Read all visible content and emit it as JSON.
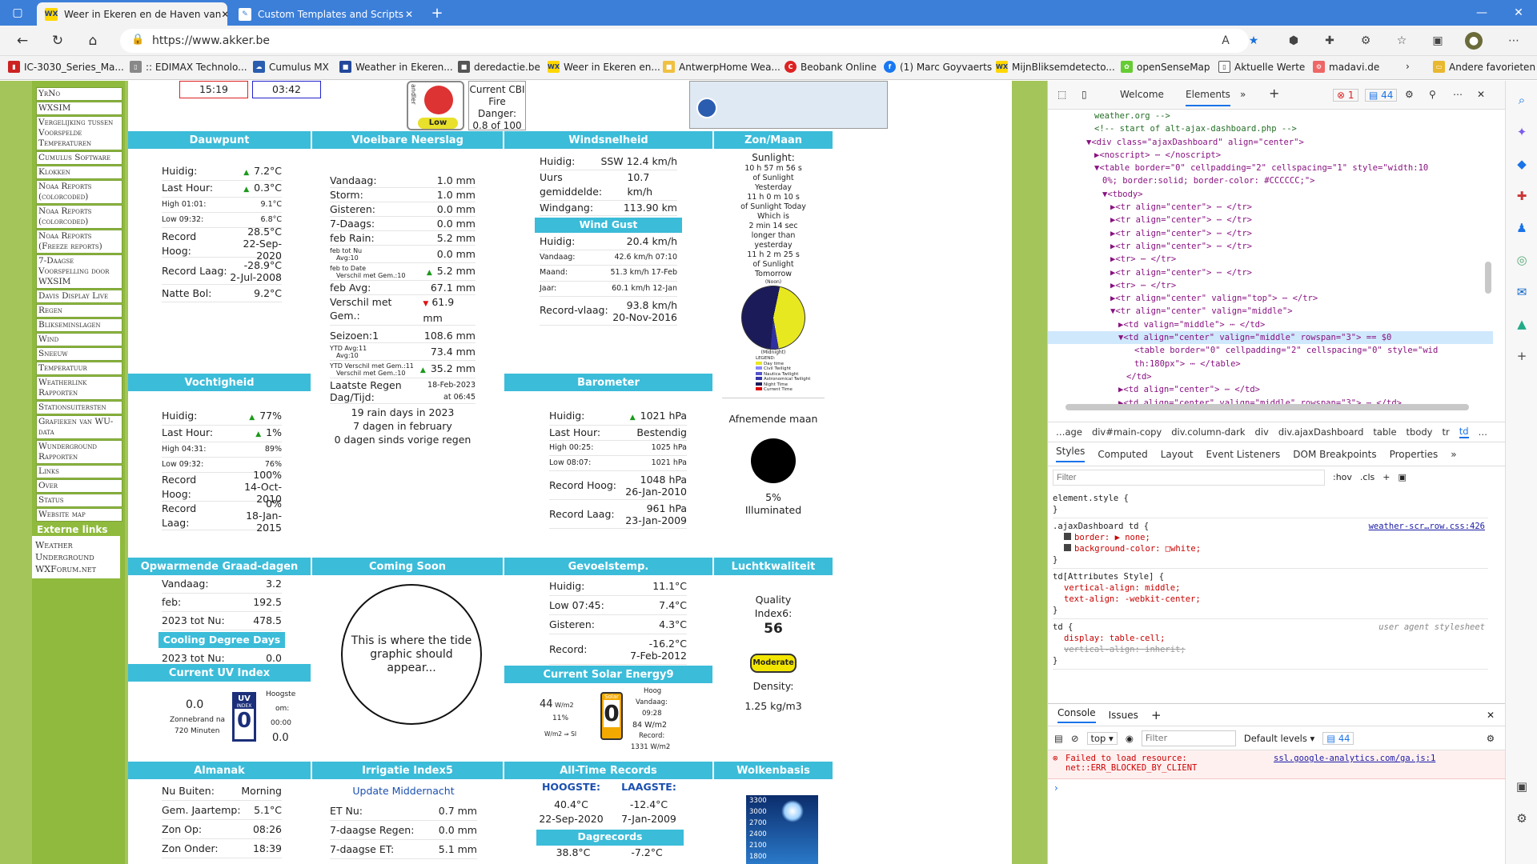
{
  "tabs": [
    {
      "label": "Weer in Ekeren en de Haven van",
      "favicon": "WX"
    },
    {
      "label": "Custom Templates and Scripts",
      "favicon": "doc"
    }
  ],
  "address": {
    "url": "https://www.akker.be"
  },
  "favorites": [
    "IC-3030_Series_Ma...",
    ":: EDIMAX Technolo...",
    "Cumulus MX",
    "Weather in Ekeren...",
    "deredactie.be",
    "Weer in Ekeren en...",
    "AntwerpHome Wea...",
    "Beobank Online",
    "(1) Marc Goyvaerts",
    "MijnBliksemdetecto...",
    "openSenseMap",
    "Aktuelle Werte",
    "madavi.de",
    "Andere favorieten"
  ],
  "sidebar": {
    "items": [
      "YrNo",
      "WXSIM",
      "Vergelijking tussen Voorspelde Temperaturen",
      "Cumulus Software",
      "Klokken",
      "Noaa Reports (colorcoded)",
      "Noaa Reports (colorcoded)",
      "Noaa Reports (Freeze reports)",
      "7-Daagse Voorspelling door WXSIM",
      "Davis Display Live",
      "Regen",
      "Blikseminslagen",
      "Wind",
      "Sneeuw",
      "Temperatuur",
      "Weatherlink Rapporten",
      "Stationsuitersten",
      "Grafieken van WU-data",
      "Wunderground Rapporten",
      "Links",
      "Over",
      "Status",
      "Website map"
    ],
    "external_header": "Externe links",
    "external": [
      "Weather Underground",
      "WXForum.net"
    ]
  },
  "top": {
    "time1": "15:19",
    "time2": "03:42",
    "cbi_label": "Current CBI Fire Danger:",
    "cbi_value": "0.8 of 100",
    "fire_badge": "Low",
    "fire_side": "andler"
  },
  "dew": {
    "header": "Dauwpunt",
    "rows": [
      [
        "Huidig:",
        "7.2°C"
      ],
      [
        "Last Hour:",
        "0.3°C"
      ],
      [
        "High 01:01:",
        "9.1°C"
      ],
      [
        "Low 09:32:",
        "6.8°C"
      ]
    ],
    "record_high": [
      "Record Hoog:",
      "28.5°C",
      "22-Sep-2020"
    ],
    "record_low": [
      "Record Laag:",
      "-28.9°C",
      "2-Jul-2008"
    ],
    "wet_bulb": [
      "Natte Bol:",
      "9.2°C"
    ]
  },
  "rain": {
    "header": "Vloeibare Neerslag",
    "rows": [
      [
        "Vandaag:",
        "1.0 mm"
      ],
      [
        "Storm:",
        "1.0 mm"
      ],
      [
        "Gisteren:",
        "0.0 mm"
      ],
      [
        "7-Daags:",
        "0.0 mm"
      ],
      [
        "feb Rain:",
        "5.2 mm"
      ]
    ],
    "feb_tot_nu": "feb tot Nu",
    "avg10": "Avg:10",
    "feb_tot_nu_val": "0.0 mm",
    "feb_to_date": "feb to Date",
    "verschil10": "Verschil met Gem.:10",
    "feb_to_date_val": "5.2 mm",
    "feb_avg": [
      "feb Avg:",
      "67.1 mm"
    ],
    "verschil": [
      "Verschil met Gem.:",
      "61.9 mm"
    ],
    "seizoen": [
      "Seizoen:1",
      "108.6 mm"
    ],
    "ytd_avg": "YTD Avg:11",
    "ytd_avg_val": "73.4 mm",
    "ytd_verschil": "YTD Verschil met Gem.:11",
    "ytd_verschil_val": "35.2 mm",
    "laatste": "Laatste Regen Dag/Tijd:",
    "laatste_date": "18-Feb-2023",
    "laatste_time": "at 06:45",
    "summary": [
      "19 rain days in 2023",
      "7 dagen in february",
      "0 dagen sinds vorige regen"
    ]
  },
  "wind": {
    "header": "Windsnelheid",
    "rows": [
      [
        "Huidig:",
        "SSW  12.4 km/h"
      ],
      [
        "Uurs gemiddelde:",
        "10.7 km/h"
      ],
      [
        "Windgang:",
        "113.90 km"
      ]
    ],
    "gust_header": "Wind Gust",
    "gust_rows": [
      [
        "Huidig:",
        "20.4 km/h"
      ],
      [
        "Vandaag:",
        "42.6 km/h 07:10"
      ],
      [
        "Maand:",
        "51.3 km/h 17-Feb"
      ],
      [
        "Jaar:",
        "60.1 km/h 12-Jan"
      ]
    ],
    "record": [
      "Record-vlaag:",
      "93.8 km/h",
      "20-Nov-2016"
    ]
  },
  "sun": {
    "header": "Zon/Maan",
    "label": "Sunlight:",
    "lines": [
      "10 h 57 m 56 s",
      "of Sunlight",
      "Yesterday",
      "11 h 0 m 10 s",
      "of Sunlight Today",
      "Which is",
      "2 min 14 sec",
      "longer than",
      "yesterday",
      "11 h 2 m 25 s",
      "of Sunlight",
      "Tomorrow"
    ],
    "noon": "(Noon)",
    "midnight": "(Midnight)",
    "legend": [
      "LEGEND:",
      "Day time",
      "Civil Twilight",
      "Nautica Twilight",
      "Astronomical Twilight",
      "Night Time",
      "Current Time"
    ],
    "moon_phase": "Afnemende maan",
    "moon_pct": "5%",
    "moon_ill": "Illuminated"
  },
  "hum": {
    "header": "Vochtigheid",
    "rows": [
      [
        "Huidig:",
        "77%"
      ],
      [
        "Last Hour:",
        "1%"
      ],
      [
        "High 04:31:",
        "89%"
      ],
      [
        "Low 09:32:",
        "76%"
      ]
    ],
    "record_high": [
      "Record Hoog:",
      "100%",
      "14-Oct-2010"
    ],
    "record_low": [
      "Record Laag:",
      "0%",
      "18-Jan-2015"
    ]
  },
  "baro": {
    "header": "Barometer",
    "rows": [
      [
        "Huidig:",
        "1021 hPa"
      ],
      [
        "Last Hour:",
        "Bestendig"
      ],
      [
        "High 00:25:",
        "1025 hPa"
      ],
      [
        "Low 08:07:",
        "1021 hPa"
      ]
    ],
    "record_high": [
      "Record Hoog:",
      "1048 hPa",
      "26-Jan-2010"
    ],
    "record_low": [
      "Record Laag:",
      "961 hPa",
      "23-Jan-2009"
    ]
  },
  "degree": {
    "header": "Opwarmende Graad-dagen",
    "rows": [
      [
        "Vandaag:",
        "3.2"
      ],
      [
        "feb:",
        "192.5"
      ],
      [
        "2023 tot Nu:",
        "478.5"
      ]
    ],
    "cool_header": "Cooling Degree Days",
    "cool_row": [
      "2023 tot Nu:",
      "0.0"
    ]
  },
  "coming": {
    "header": "Coming Soon",
    "tide": "This is where the tide graphic should appear..."
  },
  "feel": {
    "header": "Gevoelstemp.",
    "rows": [
      [
        "Huidig:",
        "11.1°C"
      ],
      [
        "Low 07:45:",
        "7.4°C"
      ],
      [
        "Gisteren:",
        "4.3°C"
      ]
    ],
    "record": [
      "Record:",
      "-16.2°C",
      "7-Feb-2012"
    ]
  },
  "air": {
    "header": "Luchtkwaliteit",
    "quality": "Quality",
    "index": "Index6:",
    "value": "56",
    "badge": "Moderate",
    "density_label": "Density:",
    "density": "1.25 kg/m3"
  },
  "uv": {
    "header": "Current UV Index",
    "value": "0.0",
    "zonne": "Zonnebrand na",
    "minuten": "720 Minuten",
    "badge_top": "UV",
    "badge_mid": "INDEX",
    "badge_val": "0",
    "hoogste": "Hoogste",
    "om": "om:",
    "time": "00:00",
    "max": "0.0"
  },
  "solar": {
    "header": "Current Solar Energy9",
    "wm": "44",
    "unit": "W/m2",
    "pct": "11%",
    "arrow": "W/m2 ⇒ SI",
    "badge": "Solar",
    "badge_val": "0",
    "hoog": "Hoog",
    "vandaag": "Vandaag:",
    "tijd": "09:28",
    "val": "84 W/m2",
    "record": "Record:",
    "record_val": "1331 W/m2"
  },
  "almanak": {
    "header": "Almanak",
    "rows": [
      [
        "Nu Buiten:",
        "Morning"
      ],
      [
        "Gem. Jaartemp:",
        "5.1°C"
      ],
      [
        "Zon Op:",
        "08:26"
      ],
      [
        "Zon Onder:",
        "18:39"
      ]
    ]
  },
  "irrig": {
    "header": "Irrigatie Index5",
    "update": "Update Middernacht",
    "rows": [
      [
        "ET Nu:",
        "0.7 mm"
      ],
      [
        "7-daagse Regen:",
        "0.0 mm"
      ],
      [
        "7-daagse ET:",
        "5.1 mm"
      ]
    ]
  },
  "records": {
    "header": "All-Time Records",
    "hoog": "HOOGSTE:",
    "laag": "LAAGSTE:",
    "hoog_val": "40.4°C",
    "hoog_date": "22-Sep-2020",
    "laag_val": "-12.4°C",
    "laag_date": "7-Jan-2009",
    "dag": "Dagrecords",
    "dag_hi": "38.8°C",
    "dag_lo": "-7.2°C"
  },
  "cloud": {
    "header": "Wolkenbasis",
    "ticks": [
      "3300",
      "3000",
      "2700",
      "2400",
      "2100",
      "1800"
    ]
  },
  "devtools": {
    "tabs": [
      "Welcome",
      "Elements"
    ],
    "errors": "1",
    "messages": "44",
    "tree": [
      {
        "t": "weather.org -->",
        "k": "cm",
        "i": 5
      },
      {
        "t": "<!-- start of alt-ajax-dashboard.php -->",
        "k": "cm",
        "i": 5
      },
      {
        "t": "▼<div class=\"ajaxDashboard\" align=\"center\">",
        "k": "tag",
        "i": 4
      },
      {
        "t": "▶<noscript> ⋯ </noscript>",
        "k": "tag",
        "i": 5
      },
      {
        "t": "▼<table border=\"0\" cellpadding=\"2\" cellspacing=\"1\" style=\"width:10",
        "k": "tag",
        "i": 5
      },
      {
        "t": "0%; border:solid; border-color: #CCCCCC;\">",
        "k": "tag",
        "i": 6
      },
      {
        "t": "▼<tbody>",
        "k": "tag",
        "i": 6
      },
      {
        "t": "▶<tr align=\"center\"> ⋯ </tr>",
        "k": "tag",
        "i": 7
      },
      {
        "t": "▶<tr align=\"center\"> ⋯ </tr>",
        "k": "tag",
        "i": 7
      },
      {
        "t": "▶<tr align=\"center\"> ⋯ </tr>",
        "k": "tag",
        "i": 7
      },
      {
        "t": "▶<tr align=\"center\"> ⋯ </tr>",
        "k": "tag",
        "i": 7
      },
      {
        "t": "▶<tr> ⋯ </tr>",
        "k": "tag",
        "i": 7
      },
      {
        "t": "▶<tr align=\"center\"> ⋯ </tr>",
        "k": "tag",
        "i": 7
      },
      {
        "t": "▶<tr> ⋯ </tr>",
        "k": "tag",
        "i": 7
      },
      {
        "t": "▶<tr align=\"center\" valign=\"top\"> ⋯ </tr>",
        "k": "tag",
        "i": 7
      },
      {
        "t": "▼<tr align=\"center\" valign=\"middle\">",
        "k": "tag",
        "i": 7
      },
      {
        "t": "▶<td valign=\"middle\"> ⋯ </td>",
        "k": "tag",
        "i": 8
      },
      {
        "t": "▼<td align=\"center\" valign=\"middle\" rowspan=\"3\"> == $0",
        "k": "sel",
        "i": 8
      },
      {
        "t": "<table border=\"0\" cellpadding=\"2\" cellspacing=\"0\" style=\"wid",
        "k": "tag",
        "i": 10
      },
      {
        "t": "th:180px\"> ⋯ </table>",
        "k": "tag",
        "i": 10
      },
      {
        "t": "</td>",
        "k": "tag",
        "i": 9
      },
      {
        "t": "▶<td align=\"center\"> ⋯ </td>",
        "k": "tag",
        "i": 8
      },
      {
        "t": "▶<td align=\"center\" valign=\"middle\" rowspan=\"3\"> ⋯ </td>",
        "k": "tag",
        "i": 8
      }
    ],
    "crumbs": [
      "…age",
      "div#main-copy",
      "div.column-dark",
      "div",
      "div.ajaxDashboard",
      "table",
      "tbody",
      "tr",
      "td",
      "…"
    ],
    "style_tabs": [
      "Styles",
      "Computed",
      "Layout",
      "Event Listeners",
      "DOM Breakpoints",
      "Properties"
    ],
    "filter_placeholder": "Filter",
    "hov": ":hov",
    "cls": ".cls",
    "rules": [
      {
        "sel": "element.style {",
        "src": "",
        "props": []
      },
      {
        "sel": ".ajaxDashboard td {",
        "src": "weather-scr…row.css:426",
        "props": [
          "border: ▶ none;",
          "background-color: □white;"
        ]
      },
      {
        "sel": "td[Attributes Style] {",
        "src": "",
        "props": [
          "vertical-align: middle;",
          "text-align: -webkit-center;"
        ]
      },
      {
        "sel": "td {",
        "src": "user agent stylesheet",
        "props": [
          "display: table-cell;",
          "vertical-align: inherit;"
        ]
      }
    ],
    "console_tabs": [
      "Console",
      "Issues"
    ],
    "console_context": "top",
    "console_filter": "Filter",
    "console_levels": "Default levels",
    "console_count": "44",
    "console_error": "Failed to load resource: net::ERR_BLOCKED_BY_CLIENT",
    "console_error_src": "ssl.google-analytics.com/ga.js:1"
  }
}
